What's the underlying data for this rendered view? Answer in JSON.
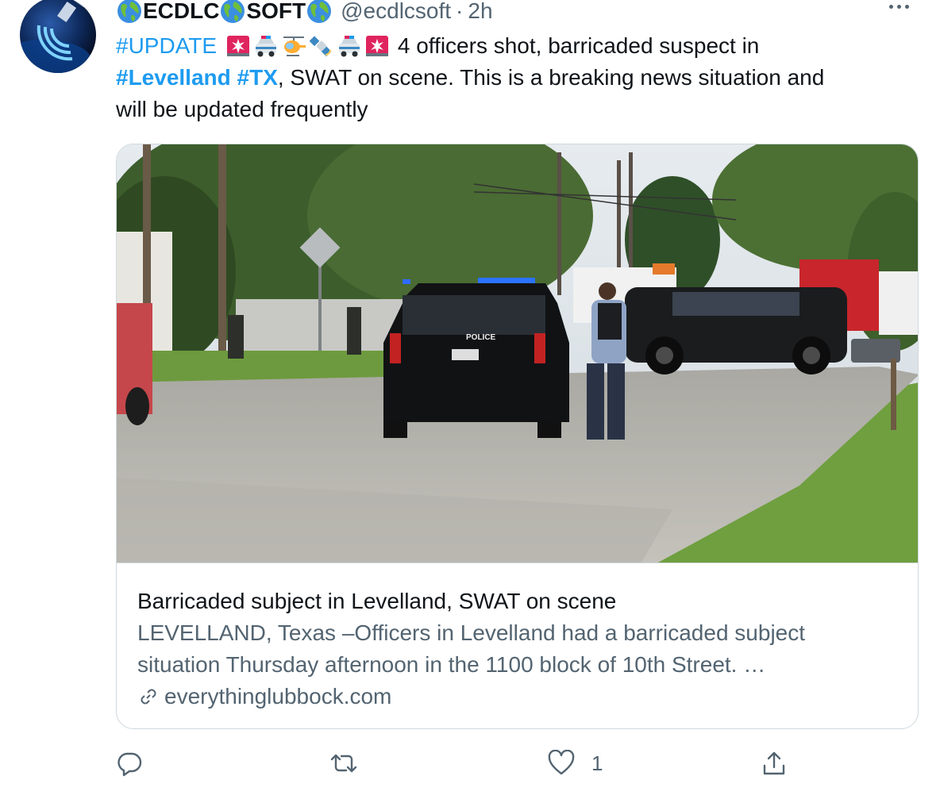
{
  "account": {
    "name_part_1": "ECDLC",
    "name_part_2": "SOFT",
    "handle": "@ecdlcsoft",
    "separator": "·",
    "time": "2h"
  },
  "tweet": {
    "line1_tag": "#UPDATE",
    "line1_emojis": [
      "rotating-light",
      "police-car",
      "helicopter",
      "satellite",
      "police-car",
      "rotating-light"
    ],
    "line1_text": " 4 officers shot, barricaded suspect in",
    "line2_tag1": "#Levelland",
    "line2_tag2": "#TX",
    "line2_text": ", SWAT on scene. This is a breaking news situation and",
    "line3_text": "will be updated frequently"
  },
  "card": {
    "title": "Barricaded subject in Levelland, SWAT on scene",
    "description_line1": "LEVELLAND, Texas –Officers in Levelland had a barricaded subject",
    "description_line2": "situation Thursday afternoon in the 1100 block of 10th Street. …",
    "domain": "everythinglubbock.com",
    "photo_text": "POLICE"
  },
  "actions": {
    "reply_count": "",
    "retweet_count": "",
    "like_count": "1",
    "share_count": ""
  },
  "colors": {
    "link": "#1d9bf0",
    "text": "#0f1419",
    "secondary": "#536471",
    "border": "#cfd9de"
  }
}
